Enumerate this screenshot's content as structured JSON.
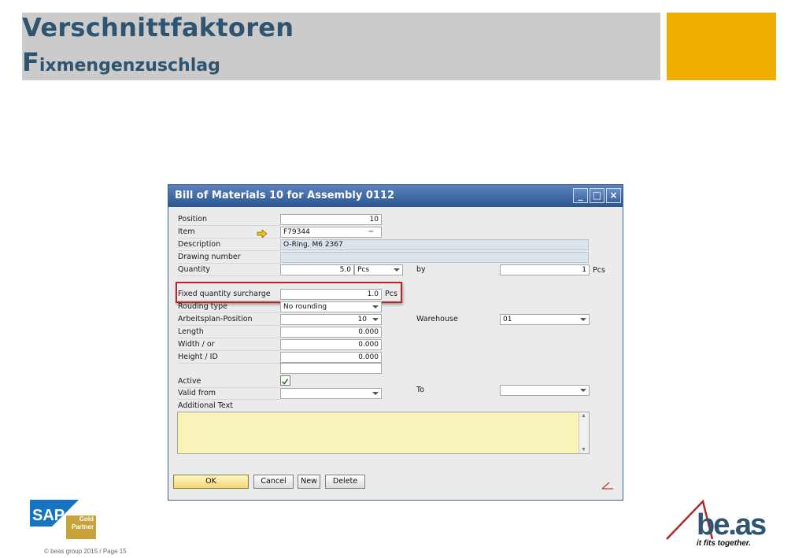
{
  "slide": {
    "title_line1": "Verschnittfaktoren",
    "title_line2_first": "F",
    "title_line2_rest": "ixmengenzuschlag",
    "accent_color": "#f0ad00",
    "footer_copyright": "© beas group 2015 / Page 15"
  },
  "logos": {
    "sap_text": "SAP",
    "sap_gold": "Gold",
    "sap_partner": "Partner",
    "beas_text": "be.as",
    "beas_tagline": "it fits together."
  },
  "window": {
    "title": "Bill of Materials 10 for Assembly 0112",
    "minimize_icon": "minimize-icon",
    "maximize_icon": "maximize-icon",
    "close_icon": "close-icon",
    "fields": {
      "position_label": "Position",
      "position_value": "10",
      "item_label": "Item",
      "item_value": "F79344",
      "description_label": "Description",
      "description_value": "O-Ring, M6 2367",
      "drawing_label": "Drawing number",
      "drawing_value": "",
      "quantity_label": "Quantity",
      "quantity_value": "5.0",
      "quantity_unit": "Pcs",
      "by_label": "by",
      "by_value": "1",
      "by_unit": "Pcs",
      "fixed_label": "Fixed quantity surcharge",
      "fixed_value": "1.0",
      "fixed_unit": "Pcs",
      "rounding_label": "Rouding type",
      "rounding_value": "No rounding",
      "arbeitsplan_label": "Arbeitsplan-Position",
      "arbeitsplan_value": "10",
      "warehouse_label": "Warehouse",
      "warehouse_value": "01",
      "length_label": "Length",
      "length_value": "0.000",
      "width_label": "Width / or",
      "width_value": "0.000",
      "height_label": "Height / ID",
      "height_value": "0.000",
      "active_label": "Active",
      "valid_from_label": "Valid from",
      "to_label": "To",
      "additional_text_label": "Additional Text"
    },
    "buttons": {
      "ok": "OK",
      "cancel": "Cancel",
      "new": "New",
      "delete": "Delete"
    }
  }
}
